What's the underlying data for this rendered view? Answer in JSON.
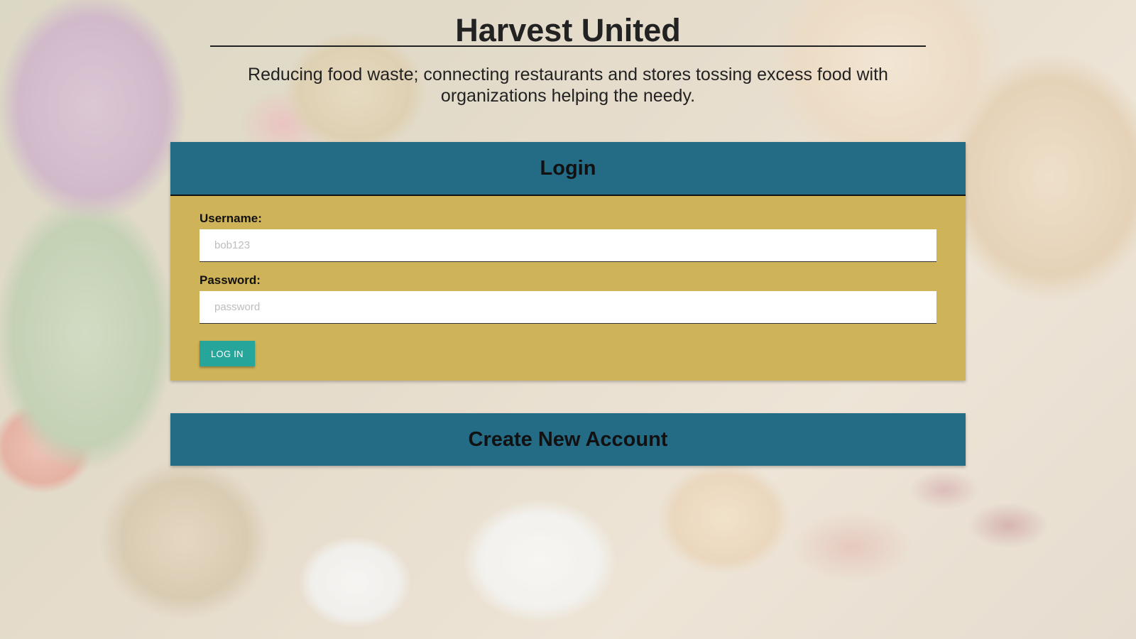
{
  "header": {
    "title": "Harvest United",
    "tagline": "Reducing food waste; connecting restaurants and stores tossing excess food with organizations helping the needy."
  },
  "login": {
    "heading": "Login",
    "username_label": "Username:",
    "username_placeholder": "bob123",
    "password_label": "Password:",
    "password_placeholder": "password",
    "button_label": "LOG IN"
  },
  "create_account": {
    "heading": "Create New Account"
  },
  "colors": {
    "header_bar": "#246b86",
    "form_body": "#cfb358",
    "button": "#26a69a"
  }
}
